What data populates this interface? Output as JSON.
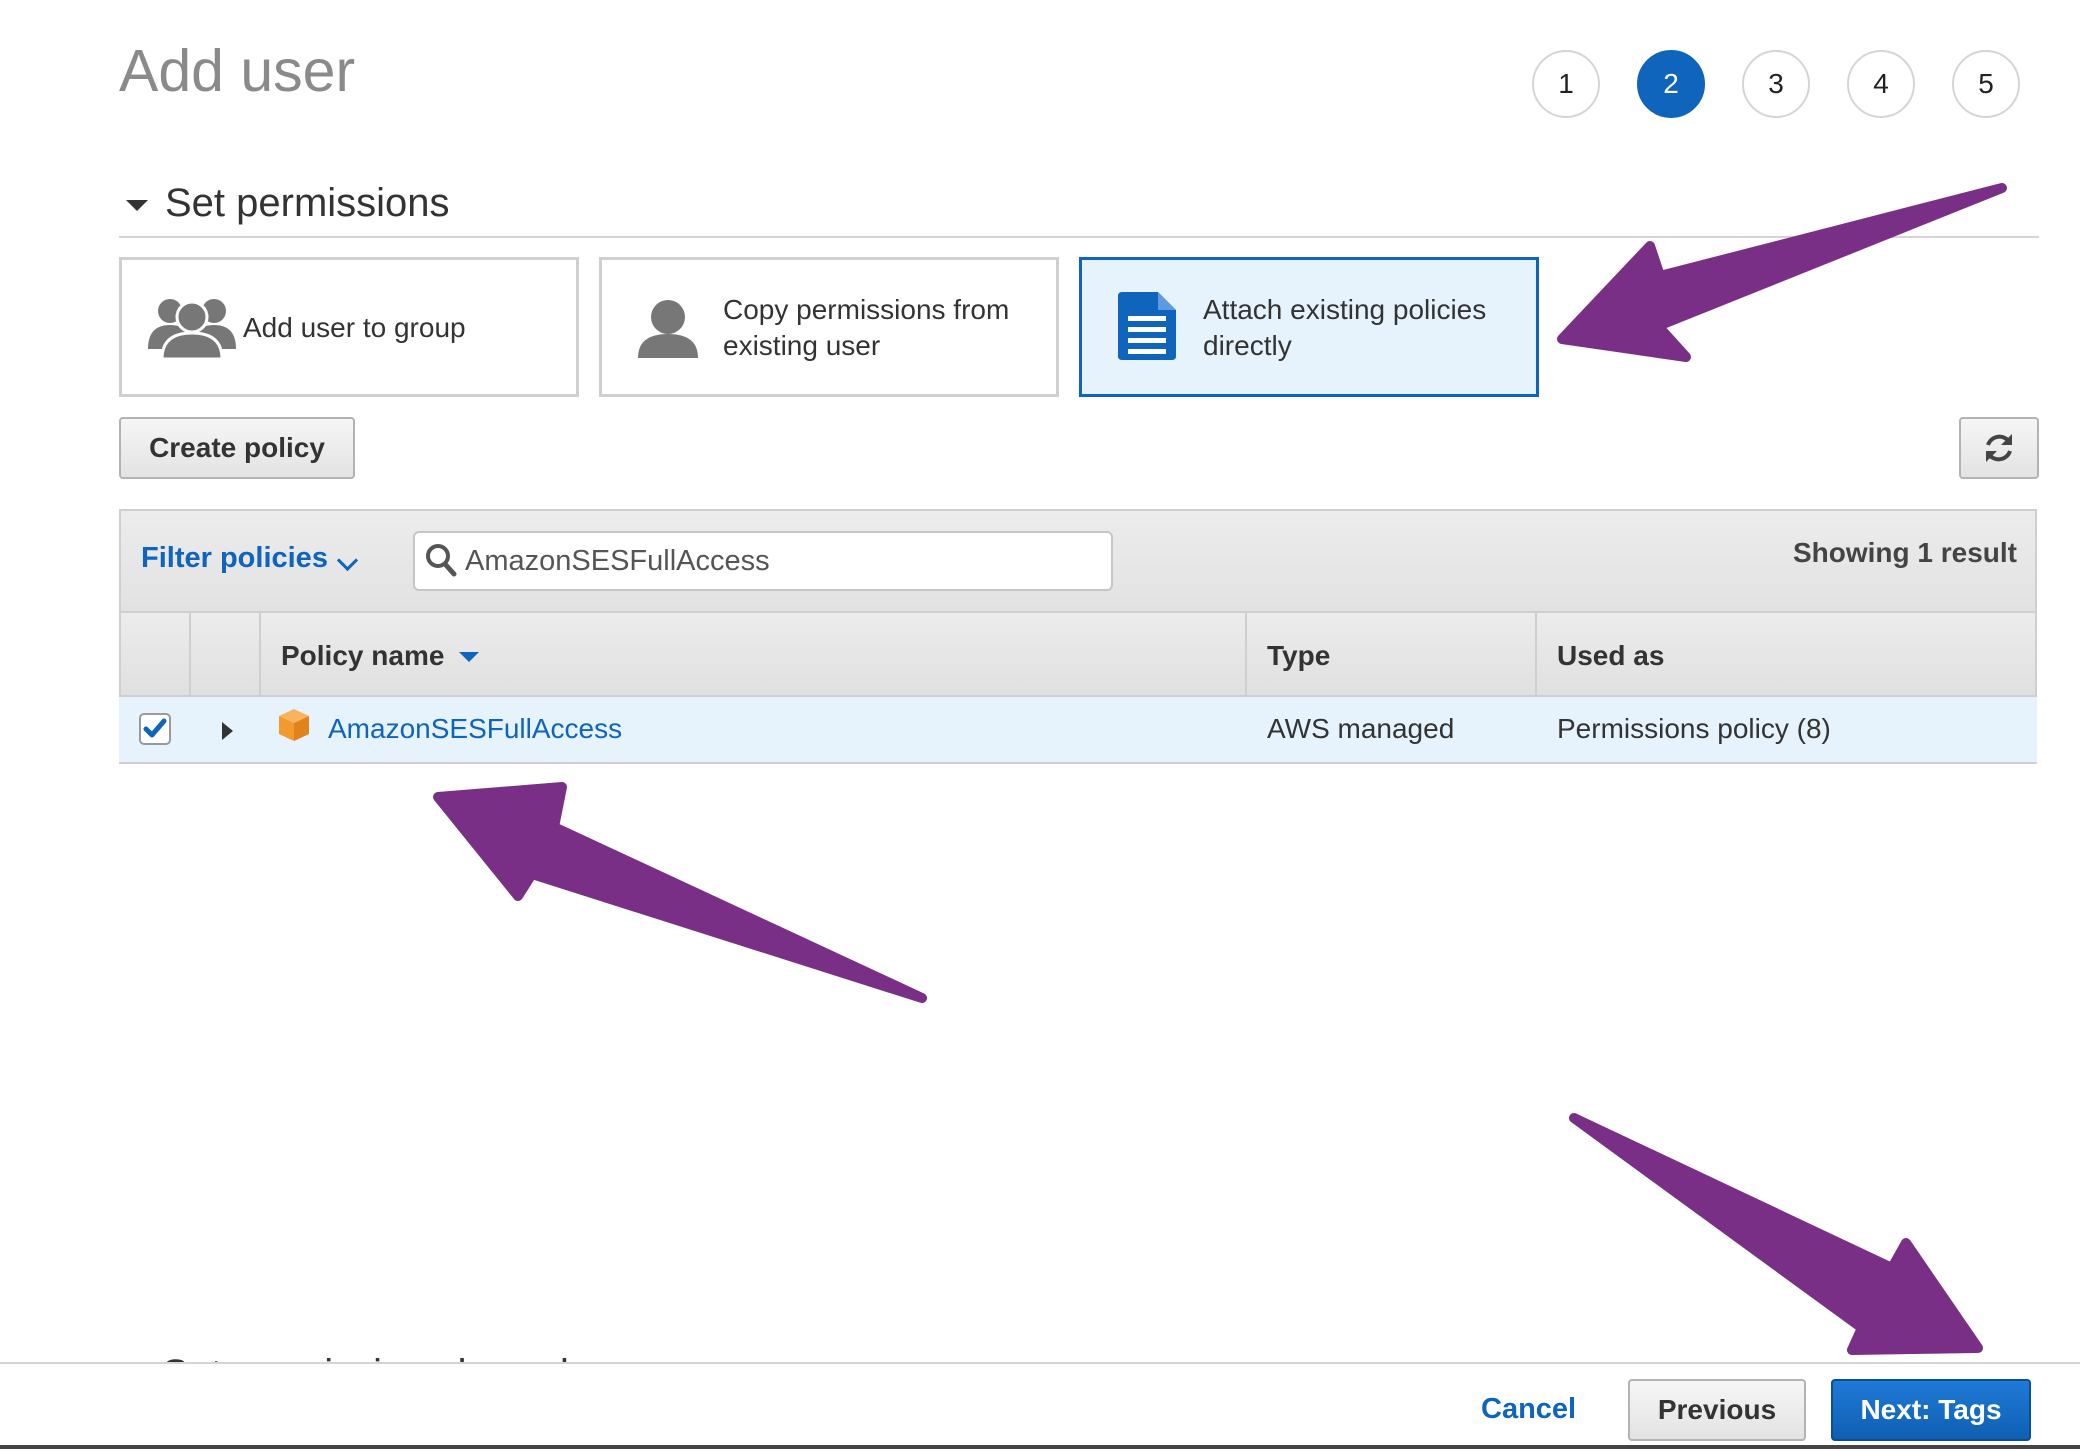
{
  "page": {
    "title": "Add user"
  },
  "steps": [
    "1",
    "2",
    "3",
    "4",
    "5"
  ],
  "active_step": "2",
  "section": {
    "title": "Set permissions"
  },
  "permission_options": [
    {
      "label": "Add user to group",
      "icon": "user-group-icon"
    },
    {
      "label": "Copy permissions from existing user",
      "icon": "user-icon"
    },
    {
      "label": "Attach existing policies directly",
      "icon": "document-icon",
      "selected": true
    }
  ],
  "toolbar": {
    "create_policy_label": "Create policy",
    "refresh_icon": "refresh-icon"
  },
  "filter": {
    "label": "Filter policies",
    "search_value": "AmazonSESFullAccess",
    "result_count": "Showing 1 result"
  },
  "table": {
    "columns": [
      "Policy name",
      "Type",
      "Used as"
    ],
    "rows": [
      {
        "checked": true,
        "name": "AmazonSESFullAccess",
        "type": "AWS managed",
        "used_as": "Permissions policy (8)",
        "icon": "package-icon"
      }
    ]
  },
  "hidden_section_title": "Set permissions boundary",
  "footer": {
    "cancel_label": "Cancel",
    "previous_label": "Previous",
    "next_label": "Next: Tags"
  },
  "colors": {
    "accent": "#0f64bb",
    "selected_bg": "#e6f2fc",
    "annotation_arrow": "#7a2f86",
    "policy_icon": "#f39a2e"
  }
}
